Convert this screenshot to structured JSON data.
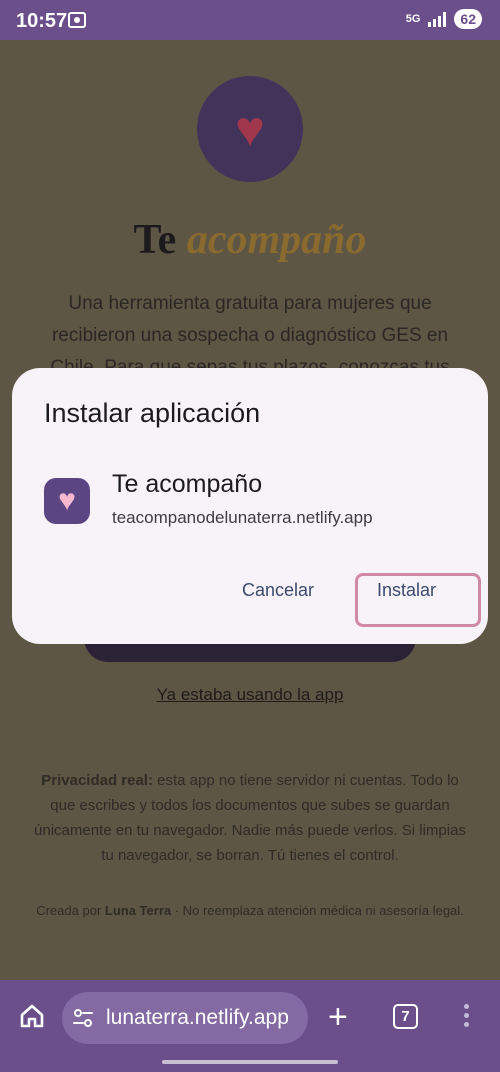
{
  "status_bar": {
    "time": "10:57",
    "network": "5G",
    "battery": "62",
    "icons": [
      "screen-record-icon",
      "signal-icon",
      "battery-icon"
    ]
  },
  "page": {
    "title_plain": "Te",
    "title_accent": "acompaño",
    "description": "Una herramienta gratuita para mujeres que recibieron una sospecha o diagnóstico GES en Chile. Para que sepas tus plazos, conozcas tus",
    "secondary_link": "Ya estaba usando la app",
    "privacy_label": "Privacidad real:",
    "privacy_text": "esta app no tiene servidor ni cuentas. Todo lo que escribes y todos los documentos que subes se guardan únicamente en tu navegador. Nadie más puede verlos. Si limpias tu navegador, se borran. Tú tienes el control.",
    "footer_prefix": "Creada por",
    "footer_author": "Luna Terra",
    "footer_suffix": "· No reemplaza atención médica ni asesoría legal."
  },
  "dialog": {
    "title": "Instalar aplicación",
    "app_name": "Te acompaño",
    "app_url": "teacompanodelunaterra.netlify.app",
    "cancel_label": "Cancelar",
    "install_label": "Instalar"
  },
  "browser_bar": {
    "url": "lunaterra.netlify.app",
    "tab_count": "7"
  },
  "colors": {
    "status_bar": "#6b4f8a",
    "dialog_bg": "#f7f3f8",
    "highlight": "#d18aa6"
  }
}
